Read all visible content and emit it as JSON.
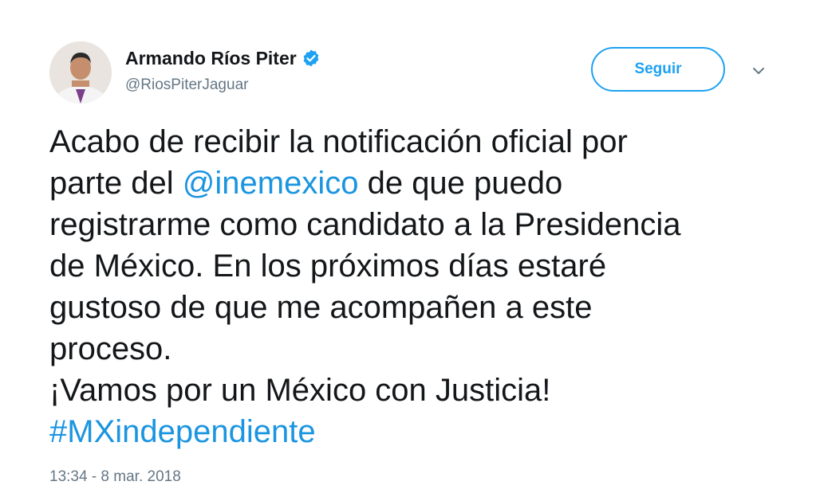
{
  "user": {
    "display_name": "Armando Ríos Piter",
    "handle": "@RiosPiterJaguar",
    "verified": true
  },
  "follow_button": {
    "label": "Seguir"
  },
  "menu": {
    "icon": "chevron-down-icon"
  },
  "tweet": {
    "line1": "Acabo de recibir la notificación oficial por",
    "line2_pre": "parte del ",
    "mention": "@inemexico",
    "line2_post": " de que puedo",
    "line3": "registrarme como candidato a la Presidencia",
    "line4": "de México. En los próximos días estaré",
    "line5": "gustoso de que me acompañen a este",
    "line6": "proceso.",
    "line7": "¡Vamos por un México con Justicia!",
    "hashtag": "#MXindependiente"
  },
  "timestamp": "13:34 - 8 mar. 2018",
  "colors": {
    "accent": "#1da1f2",
    "link": "#1b95e0",
    "text": "#14171a",
    "secondary": "#657786"
  }
}
